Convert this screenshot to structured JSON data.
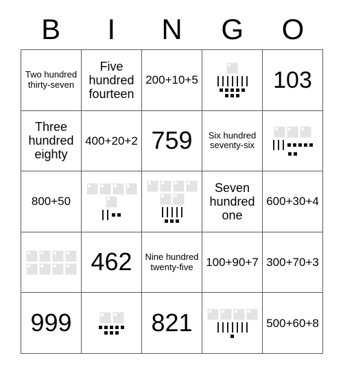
{
  "header": {
    "letters": [
      "B",
      "I",
      "N",
      "G",
      "O"
    ]
  },
  "card": {
    "columns": 5,
    "rows": 5,
    "cells": [
      {
        "id": "B1",
        "kind": "words",
        "text": "Two hundred thirty-seven",
        "size": "sm"
      },
      {
        "id": "I1",
        "kind": "words",
        "text": "Five hundred fourteen",
        "size": "md"
      },
      {
        "id": "N1",
        "kind": "expr",
        "text": "200+10+5"
      },
      {
        "id": "G1",
        "kind": "blocks",
        "hundreds": 1,
        "tens": 7,
        "ones": 8,
        "value": 178
      },
      {
        "id": "O1",
        "kind": "number",
        "text": "103",
        "size": "lg"
      },
      {
        "id": "B2",
        "kind": "words",
        "text": "Three hundred eighty",
        "size": "md"
      },
      {
        "id": "I2",
        "kind": "expr",
        "text": "400+20+2"
      },
      {
        "id": "N2",
        "kind": "number",
        "text": "759",
        "size": "xl"
      },
      {
        "id": "G2",
        "kind": "words",
        "text": "Six hundred seventy-six",
        "size": "sm"
      },
      {
        "id": "O2",
        "kind": "blocks",
        "hundreds": 3,
        "tens": 3,
        "ones": 7,
        "value": 337
      },
      {
        "id": "B3",
        "kind": "expr",
        "text": "800+50"
      },
      {
        "id": "I3",
        "kind": "blocks",
        "hundreds": 5,
        "tens": 2,
        "ones": 2,
        "value": 522
      },
      {
        "id": "N3",
        "kind": "blocks",
        "hundreds": 6,
        "tens": 5,
        "ones": 3,
        "value": 653
      },
      {
        "id": "G3",
        "kind": "words",
        "text": "Seven hundred one",
        "size": "md"
      },
      {
        "id": "O3",
        "kind": "expr",
        "text": "600+30+4"
      },
      {
        "id": "B4",
        "kind": "blocks",
        "hundreds": 8,
        "tens": 0,
        "ones": 0,
        "value": 800
      },
      {
        "id": "I4",
        "kind": "number",
        "text": "462",
        "size": "xl"
      },
      {
        "id": "N4",
        "kind": "words",
        "text": "Nine hundred twenty-five",
        "size": "sm"
      },
      {
        "id": "G4",
        "kind": "expr",
        "text": "100+90+7"
      },
      {
        "id": "O4",
        "kind": "expr",
        "text": "300+70+3"
      },
      {
        "id": "B5",
        "kind": "number",
        "text": "999",
        "size": "xl"
      },
      {
        "id": "I5",
        "kind": "blocks",
        "hundreds": 2,
        "tens": 0,
        "ones": 8,
        "value": 208
      },
      {
        "id": "N5",
        "kind": "number",
        "text": "821",
        "size": "xl"
      },
      {
        "id": "G5",
        "kind": "blocks",
        "hundreds": 4,
        "tens": 7,
        "ones": 1,
        "value": 471
      },
      {
        "id": "O5",
        "kind": "expr",
        "text": "500+60+8"
      }
    ]
  },
  "colors": {
    "grid_line": "#595959",
    "flat_fill": "#e3e3e3",
    "rod_fill": "#1a1a1a",
    "unit_fill": "#111111",
    "background": "#ffffff",
    "text": "#000000"
  }
}
